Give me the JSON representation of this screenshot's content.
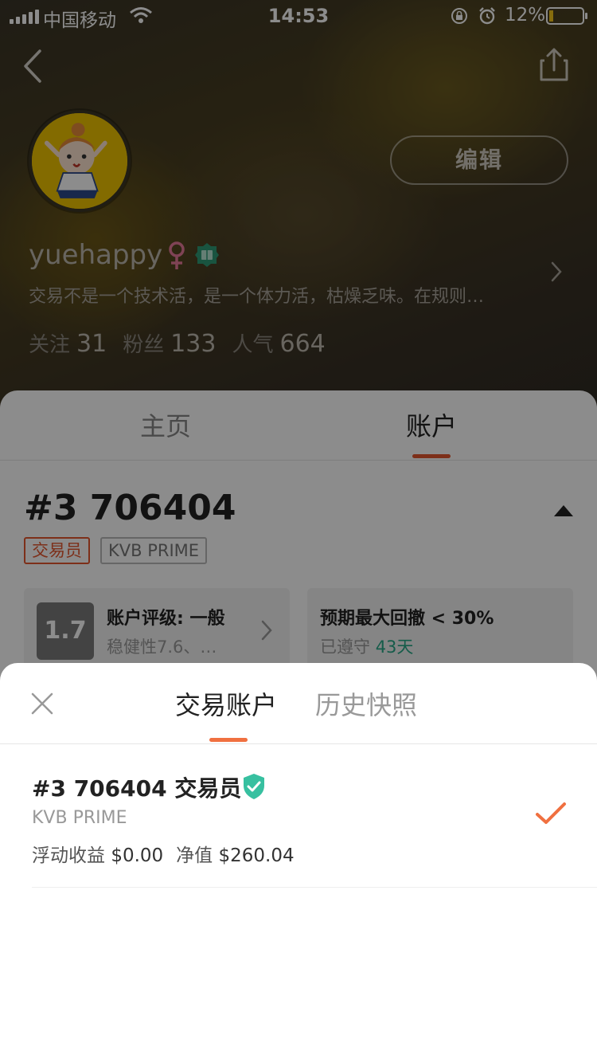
{
  "status_bar": {
    "carrier": "中国移动",
    "time": "14:53",
    "battery": "12%"
  },
  "profile": {
    "edit_label": "编辑",
    "username": "yuehappy",
    "bio": "交易不是一个技术活，是一个体力活，枯燥乏味。在规则…",
    "stats": [
      {
        "label": "关注",
        "value": "31"
      },
      {
        "label": "粉丝",
        "value": "133"
      },
      {
        "label": "人气",
        "value": "664"
      }
    ]
  },
  "tabs": {
    "home": "主页",
    "account": "账户"
  },
  "account_card": {
    "title": "#3 706404",
    "tag_trader": "交易员",
    "tag_broker": "KVB PRIME",
    "rating_score": "1.7",
    "rating_title": "账户评级: 一般",
    "rating_sub": "稳健性7.6、…",
    "drawdown_title": "预期最大回撤 < 30%",
    "drawdown_sub": "已遵守",
    "drawdown_days": "43天"
  },
  "sheet": {
    "tab_accounts": "交易账户",
    "tab_history": "历史快照",
    "accounts": [
      {
        "name": "#3 706404 交易员",
        "broker": "KVB PRIME",
        "float_label": "浮动收益",
        "float_value": "$0.00",
        "equity_label": "净值",
        "equity_value": "$260.04"
      }
    ]
  },
  "colors": {
    "accent": "#e4572e",
    "green": "#27a887",
    "check": "#f07040"
  },
  "icons": [
    "back-icon",
    "share-icon",
    "gender-female-icon",
    "badge-icon",
    "chevron-right-icon",
    "collapse-arrow-icon",
    "close-icon",
    "shield-check-icon",
    "checkmark-icon",
    "wifi-icon",
    "lock-rotation-icon",
    "alarm-icon",
    "battery-icon"
  ]
}
